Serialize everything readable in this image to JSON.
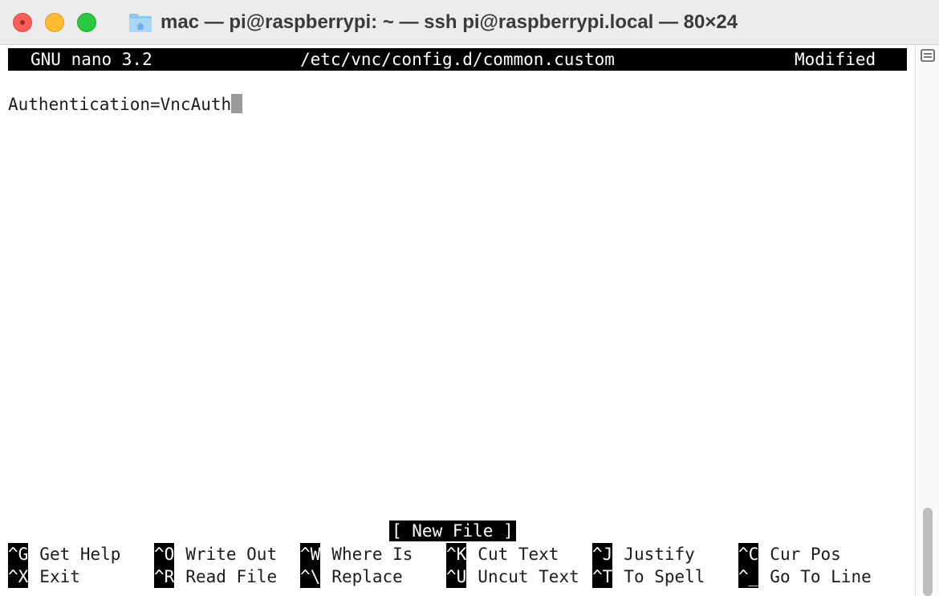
{
  "window": {
    "title": "mac — pi@raspberrypi: ~ — ssh pi@raspberrypi.local — 80×24"
  },
  "nano": {
    "version": "GNU nano 3.2",
    "filename": "/etc/vnc/config.d/common.custom",
    "state": "Modified"
  },
  "content": {
    "line1": "Authentication=VncAuth"
  },
  "status": "[ New File ]",
  "shortcuts": [
    {
      "key": "^G",
      "label": "Get Help"
    },
    {
      "key": "^O",
      "label": "Write Out"
    },
    {
      "key": "^W",
      "label": "Where Is"
    },
    {
      "key": "^K",
      "label": "Cut Text"
    },
    {
      "key": "^J",
      "label": "Justify"
    },
    {
      "key": "^C",
      "label": "Cur Pos"
    },
    {
      "key": "^X",
      "label": "Exit"
    },
    {
      "key": "^R",
      "label": "Read File"
    },
    {
      "key": "^\\",
      "label": "Replace"
    },
    {
      "key": "^U",
      "label": "Uncut Text"
    },
    {
      "key": "^T",
      "label": "To Spell"
    },
    {
      "key": "^_",
      "label": "Go To Line"
    }
  ],
  "icons": {
    "folder": "home-folder-icon",
    "scroll": "split-pane-icon"
  },
  "colors": {
    "close": "#fe5f57",
    "minimize": "#febc2e",
    "zoom": "#28c840",
    "inverse_bg": "#000000",
    "cursor": "#9a9a9a"
  }
}
